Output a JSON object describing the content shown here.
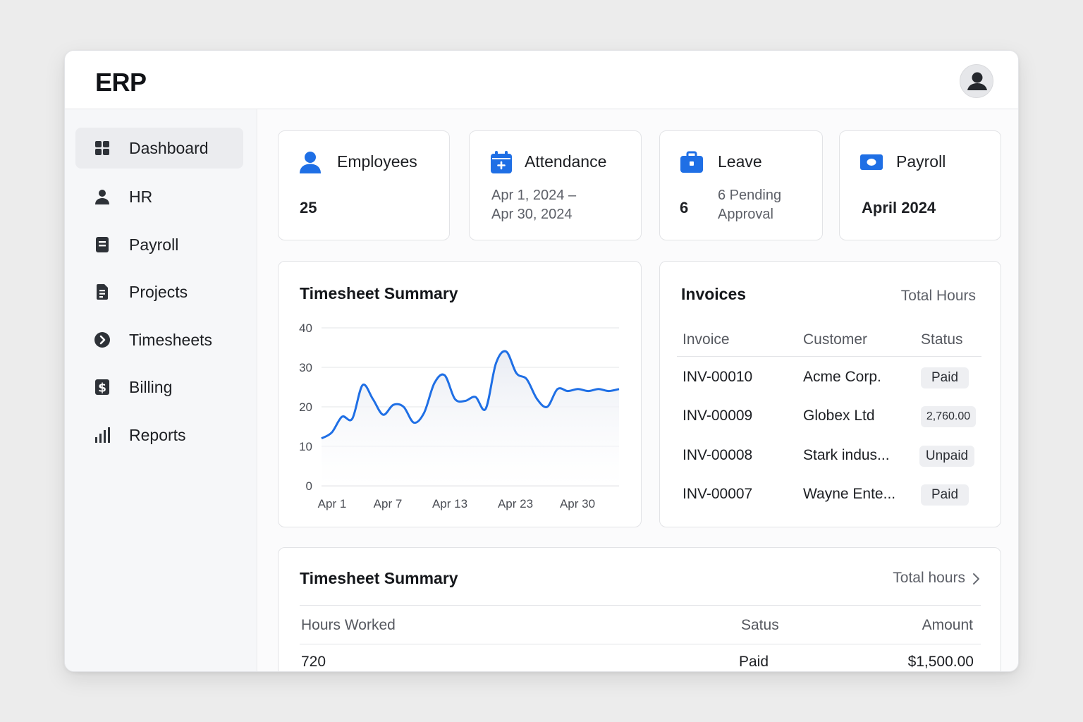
{
  "app": {
    "title": "ERP"
  },
  "sidebar": {
    "items": [
      {
        "label": "Dashboard",
        "icon": "grid-icon",
        "active": true
      },
      {
        "label": "HR",
        "icon": "person-icon"
      },
      {
        "label": "Payroll",
        "icon": "document-icon"
      },
      {
        "label": "Projects",
        "icon": "file-icon"
      },
      {
        "label": "Timesheets",
        "icon": "chevron-circle-icon"
      },
      {
        "label": "Billing",
        "icon": "dollar-icon"
      },
      {
        "label": "Reports",
        "icon": "bar-chart-icon"
      }
    ]
  },
  "stats": {
    "employees": {
      "title": "Employees",
      "value": "25"
    },
    "attendance": {
      "title": "Attendance",
      "range_line1": "Apr 1, 2024 –",
      "range_line2": "Apr 30, 2024"
    },
    "leave": {
      "title": "Leave",
      "value": "6",
      "sub_line1": "6 Pending",
      "sub_line2": "Approval"
    },
    "payroll": {
      "title": "Payroll",
      "value": "April 2024"
    }
  },
  "timesheet_chart": {
    "title": "Timesheet Summary",
    "y_ticks": [
      "40",
      "30",
      "20",
      "10",
      "0"
    ],
    "x_ticks": [
      "Apr 1",
      "Apr 7",
      "Apr 13",
      "Apr 23",
      "Apr 30"
    ]
  },
  "chart_data": {
    "type": "area",
    "title": "Timesheet Summary",
    "ylim": [
      0,
      40
    ],
    "grid": true,
    "x_labels": [
      "Apr 1",
      "Apr 7",
      "Apr 13",
      "Apr 23",
      "Apr 30"
    ],
    "x": [
      1,
      2,
      3,
      4,
      5,
      6,
      7,
      8,
      9,
      10,
      11,
      12,
      13,
      14,
      15,
      16,
      17,
      18,
      19,
      20,
      21,
      22,
      23,
      24,
      25,
      26,
      27,
      28,
      29,
      30
    ],
    "values": [
      12,
      13.5,
      17.5,
      17,
      25.5,
      22,
      18,
      20.5,
      20,
      16,
      18.5,
      26,
      28,
      22,
      21.5,
      22.5,
      19.5,
      31,
      34,
      28.5,
      27,
      22,
      20,
      24.5,
      24,
      24.5,
      24,
      24.5,
      24,
      24.5
    ],
    "color": "#1f6fe5"
  },
  "invoices": {
    "title": "Invoices",
    "total_label": "Total Hours",
    "columns": [
      "Invoice",
      "Customer",
      "Status"
    ],
    "rows": [
      {
        "invoice": "INV-00010",
        "customer": "Acme Corp.",
        "status": "Paid"
      },
      {
        "invoice": "INV-00009",
        "customer": "Globex Ltd",
        "status": "2,760.00"
      },
      {
        "invoice": "INV-00008",
        "customer": "Stark indus...",
        "status": "Unpaid"
      },
      {
        "invoice": "INV-00007",
        "customer": "Wayne Ente...",
        "status": "Paid"
      }
    ]
  },
  "timesheet_table": {
    "title": "Timesheet Summary",
    "link": "Total hours",
    "columns": [
      "Hours Worked",
      "Satus",
      "Amount"
    ],
    "rows": [
      {
        "hours": "720",
        "status": "Paid",
        "amount": "$1,500.00"
      }
    ]
  },
  "colors": {
    "accent": "#1f6fe5",
    "text": "#1d1f23",
    "muted": "#5d6068"
  }
}
